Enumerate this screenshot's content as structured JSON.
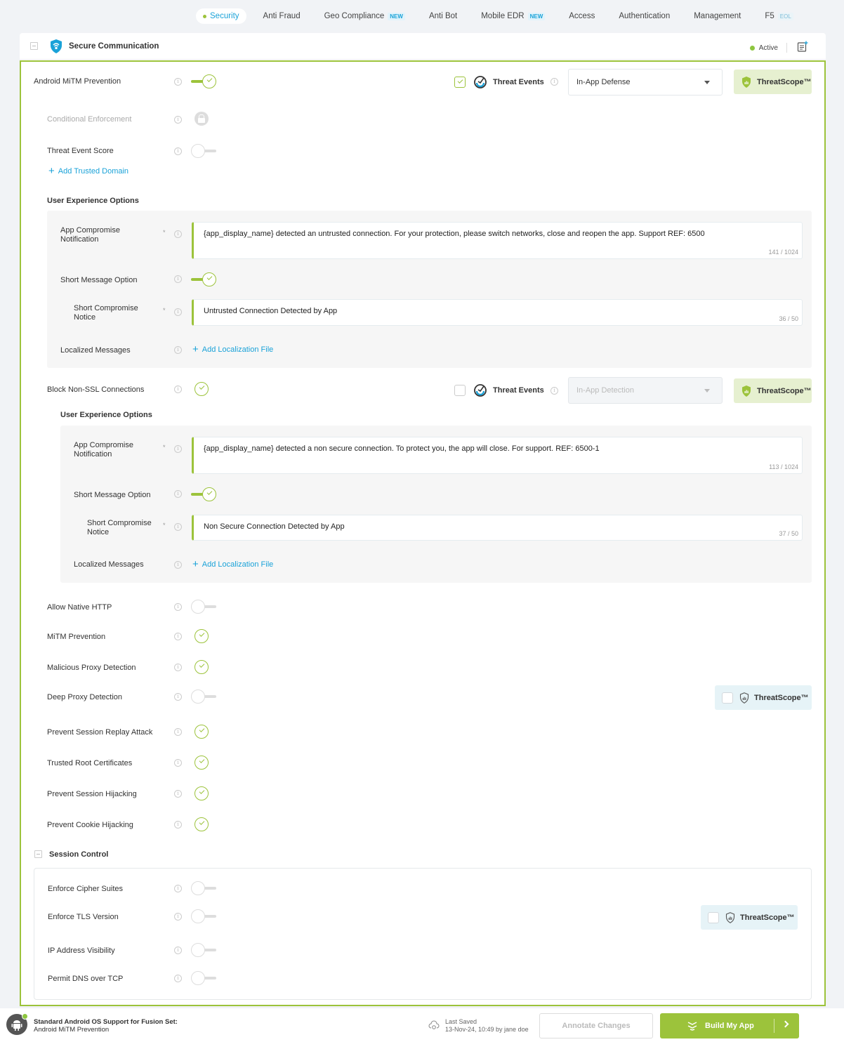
{
  "nav": {
    "tabs": [
      {
        "label": "Security",
        "active": true,
        "badge": ""
      },
      {
        "label": "Anti Fraud",
        "badge": ""
      },
      {
        "label": "Geo Compliance",
        "badge": "NEW"
      },
      {
        "label": "Anti Bot",
        "badge": ""
      },
      {
        "label": "Mobile EDR",
        "badge": "NEW"
      },
      {
        "label": "Access",
        "badge": ""
      },
      {
        "label": "Authentication",
        "badge": ""
      },
      {
        "label": "Management",
        "badge": ""
      },
      {
        "label": "F5",
        "badge": "EOL"
      }
    ]
  },
  "card": {
    "title": "Secure Communication",
    "status": "Active"
  },
  "android_mitm": {
    "label": "Android MiTM Prevention",
    "enabled": true,
    "threat_events_label": "Threat Events",
    "threat_events_checked": true,
    "select_value": "In-App Defense",
    "threatscope_label": "ThreatScope™"
  },
  "conditional": {
    "label": "Conditional Enforcement",
    "locked": true
  },
  "threat_event_score": {
    "label": "Threat Event Score",
    "enabled": false
  },
  "add_trusted_domain": "Add Trusted Domain",
  "ux1": {
    "title": "User Experience Options",
    "app_notification_label": "App Compromise Notification",
    "app_notification_value": "{app_display_name} detected an untrusted connection. For your protection, please switch networks, close and reopen the app. Support REF: 6500",
    "app_notification_count": "141 / 1024",
    "short_msg_label": "Short Message Option",
    "short_notice_label": "Short Compromise Notice",
    "short_notice_value": "Untrusted Connection Detected by App",
    "short_notice_count": "36 / 50",
    "localized_label": "Localized Messages",
    "add_localization": "Add Localization File"
  },
  "block_non_ssl": {
    "label": "Block Non-SSL Connections",
    "threat_events_label": "Threat Events",
    "threat_events_checked": false,
    "select_value": "In-App Detection",
    "threatscope_label": "ThreatScope™"
  },
  "ux2": {
    "title": "User Experience Options",
    "app_notification_label": "App Compromise Notification",
    "app_notification_value": "{app_display_name} detected a non secure connection. To protect you, the app will close. For support. REF: 6500-1",
    "app_notification_count": "113 / 1024",
    "short_msg_label": "Short Message Option",
    "short_notice_label": "Short Compromise Notice",
    "short_notice_value": "Non Secure Connection Detected by App",
    "short_notice_count": "37 / 50",
    "localized_label": "Localized Messages",
    "add_localization": "Add Localization File"
  },
  "features": [
    {
      "label": "Allow Native HTTP",
      "state": "off"
    },
    {
      "label": "MiTM Prevention",
      "state": "checked"
    },
    {
      "label": "Malicious Proxy Detection",
      "state": "checked"
    },
    {
      "label": "Deep Proxy Detection",
      "state": "off",
      "threatscope": "ThreatScope™"
    },
    {
      "label": "Prevent Session Replay Attack",
      "state": "checked"
    },
    {
      "label": "Trusted Root Certificates",
      "state": "checked"
    },
    {
      "label": "Prevent Session Hijacking",
      "state": "checked"
    },
    {
      "label": "Prevent Cookie Hijacking",
      "state": "checked"
    }
  ],
  "session_control": {
    "title": "Session Control",
    "items": [
      {
        "label": "Enforce Cipher Suites",
        "state": "off"
      },
      {
        "label": "Enforce TLS Version",
        "state": "off",
        "threatscope": "ThreatScope™"
      },
      {
        "label": "IP Address Visibility",
        "state": "off"
      },
      {
        "label": "Permit DNS over TCP",
        "state": "off"
      }
    ]
  },
  "footer": {
    "support_title": "Standard Android OS Support for Fusion Set:",
    "support_sub": "Android MiTM Prevention",
    "last_saved_label": "Last Saved",
    "last_saved_value": "13-Nov-24, 10:49 by jane doe",
    "annotate_label": "Annotate Changes",
    "build_label": "Build My App"
  },
  "colors": {
    "accent": "#9cc33b",
    "link": "#1aa2d8"
  }
}
